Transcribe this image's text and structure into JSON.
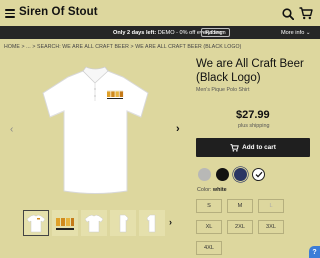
{
  "header": {
    "brand": "Siren Of Stout",
    "icons": [
      "menu-icon",
      "search-icon",
      "cart-icon"
    ]
  },
  "promo": {
    "bold_text": "Only 2 days left:",
    "text": "DEMO - 0% off everything",
    "redeem_label": "Redeem",
    "more_info_label": "More info"
  },
  "breadcrumb": "HOME  >  ...  >  SEARCH: WE ARE ALL CRAFT BEER  >  WE ARE ALL CRAFT BEER (BLACK LOGO)",
  "product": {
    "title": "We are All Craft Beer (Black Logo)",
    "subtitle": "Men's Pique Polo Shirt",
    "price": "$27.99",
    "shipping": "plus shipping",
    "add_to_cart_label": "Add to cart",
    "color_label": "Color:",
    "color_value": "white"
  },
  "swatches": [
    {
      "name": "gray",
      "color": "#b8b8b6"
    },
    {
      "name": "black",
      "color": "#111111"
    },
    {
      "name": "navy",
      "color": "#2a3563"
    },
    {
      "name": "white",
      "color": "#ffffff",
      "selected": true
    }
  ],
  "sizes": [
    {
      "label": "S",
      "available": true
    },
    {
      "label": "M",
      "available": true
    },
    {
      "label": "L",
      "available": false
    },
    {
      "label": "XL",
      "available": true
    },
    {
      "label": "2XL",
      "available": true
    },
    {
      "label": "3XL",
      "available": true
    },
    {
      "label": "4XL",
      "available": true
    }
  ],
  "help_label": "?"
}
